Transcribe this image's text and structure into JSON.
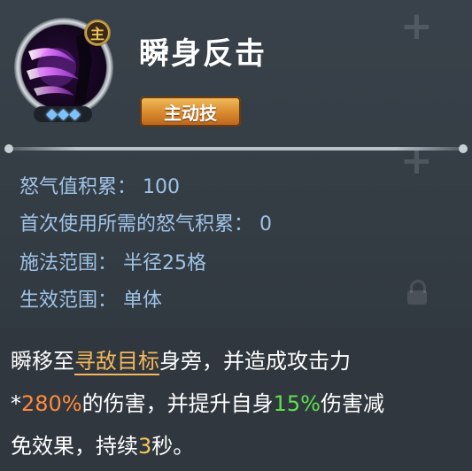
{
  "skill": {
    "name": "瞬身反击",
    "badge": "主",
    "type_tag": "主动技",
    "star_count": 3
  },
  "stats": {
    "rage_accum": "怒气值积累： 100",
    "first_use_rage": "首次使用所需的怒气积累： 0",
    "cast_range": "施法范围： 半径25格",
    "effect_range": "生效范围： 单体"
  },
  "description": {
    "l1_a": "瞬移至",
    "l1_target": "寻敌目标",
    "l1_b": "身旁，并造成攻击力",
    "l2_a": "*",
    "l2_pct": "280%",
    "l2_b": "的伤害，并提升自身",
    "l2_buff": "15%",
    "l2_c": "伤害减",
    "l3_a": "免效果，持续",
    "l3_num": "3",
    "l3_b": "秒。"
  },
  "colors": {
    "stat_text": "#9fc3e6",
    "highlight_target": "#f4b85a",
    "highlight_damage": "#ff8a3d",
    "highlight_buff": "#5fe04b",
    "highlight_duration": "#f4c860"
  }
}
